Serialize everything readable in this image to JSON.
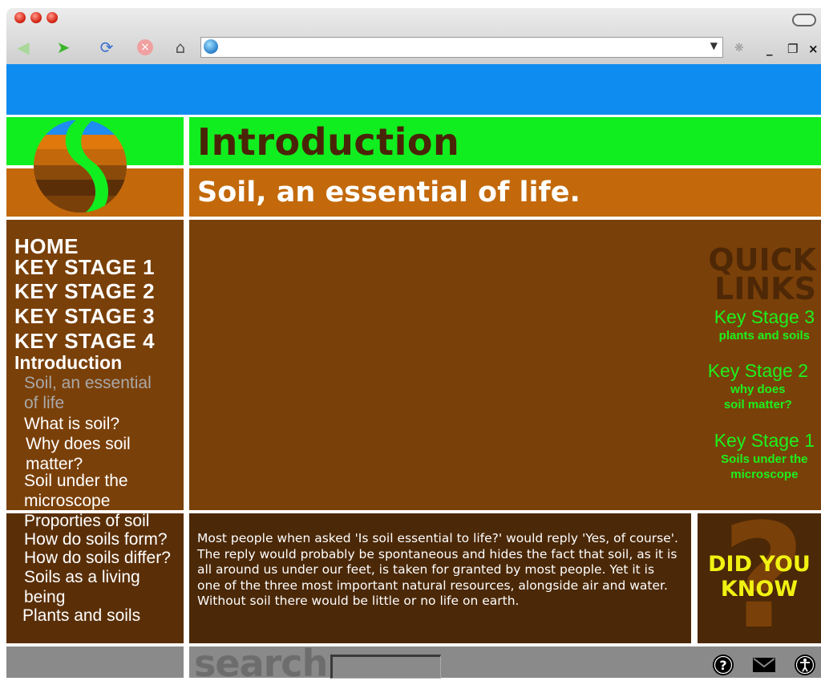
{
  "browser": {
    "back_icon": "back-arrow-icon",
    "forward_icon": "forward-arrow-icon",
    "refresh_icon": "refresh-icon",
    "stop_icon": "stop-icon",
    "home_icon": "home-icon",
    "url": "",
    "min_label": "_",
    "max_label": "□",
    "close_label": "×"
  },
  "header": {
    "title": "Introduction",
    "subtitle": "Soil, an essential of life."
  },
  "nav": {
    "home": "HOME",
    "ks1": "KEY STAGE 1",
    "ks2": "KEY STAGE 2",
    "ks3": "KEY STAGE 3",
    "ks4": "KEY STAGE 4",
    "section": "Introduction",
    "items": [
      {
        "line1": "Soil, an essential",
        "line2": "of life"
      },
      {
        "line1": "What is soil?"
      },
      {
        "line1": "Why does soil",
        "line2": "matter?"
      },
      {
        "line1": "Soil under the",
        "line2": "microscope"
      },
      {
        "line1": "Proporties of soil"
      },
      {
        "line1": "How do soils form?"
      },
      {
        "line1": "How do soils differ?"
      },
      {
        "line1": "Soils as a living",
        "line2": "being"
      },
      {
        "line1": "Plants and soils"
      }
    ],
    "active_color": "#a9a9a9"
  },
  "quick_links": {
    "heading_1": "QUICK",
    "heading_2": "LINKS",
    "links": [
      {
        "stage": "Key Stage 3",
        "line1": "plants and soils"
      },
      {
        "stage": "Key Stage 2",
        "line1": "why does",
        "line2": "soil matter?"
      },
      {
        "stage": "Key Stage 1",
        "line1": "Soils under the",
        "line2": "microscope"
      }
    ]
  },
  "body_text": "Most people when asked 'Is soil essential to life?' would reply 'Yes, of course'.  The reply would probably be spontaneous and hides the fact that soil, as it is all around us under our feet, is taken for granted by most people. Yet it is one of the three most important natural resources, alongside air and water. Without soil there would be little or no life on earth.",
  "did_you_know": {
    "line1": "DID YOU",
    "line2": "KNOW",
    "qmark": "?"
  },
  "footer": {
    "search_label": "search",
    "search_value": "",
    "help_icon": "help-icon",
    "mail_icon": "mail-icon",
    "accessibility_icon": "accessibility-icon"
  },
  "colors": {
    "blue_bar": "#0f8cf0",
    "green": "#11ee1f",
    "orange": "#c3690b",
    "brown": "#7a4009",
    "dark_brown": "#4b2807",
    "quick_link_green": "#1df01d",
    "did_you_know_yellow": "#f1f212"
  }
}
